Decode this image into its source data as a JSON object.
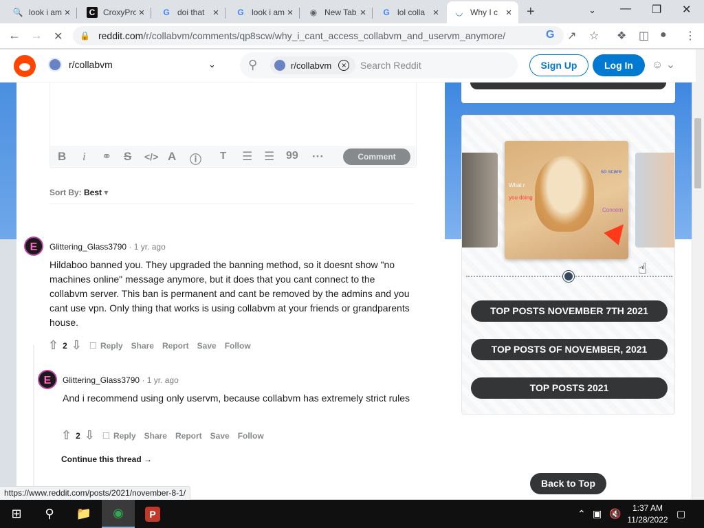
{
  "browser": {
    "tabs": [
      {
        "title": "look i am",
        "icon": "google-search-icon",
        "active": false
      },
      {
        "title": "CroxyProxy",
        "icon": "croxyproxy-icon",
        "active": false
      },
      {
        "title": "doi that",
        "icon": "google-icon",
        "active": false
      },
      {
        "title": "look i am",
        "icon": "google-icon",
        "active": false
      },
      {
        "title": "New Tab",
        "icon": "chrome-icon",
        "active": false
      },
      {
        "title": "lol colla",
        "icon": "google-icon",
        "active": false
      },
      {
        "title": "Why I c",
        "icon": "loading-icon",
        "active": true
      }
    ],
    "url_host": "reddit.com",
    "url_path": "/r/collabvm/comments/qp8scw/why_i_cant_access_collabvm_and_uservm_anymore/",
    "status_url": "https://www.reddit.com/posts/2021/november-8-1/"
  },
  "reddit_header": {
    "subreddit": "r/collabvm",
    "search_chip": "r/collabvm",
    "search_placeholder": "Search Reddit",
    "sign_up": "Sign Up",
    "log_in": "Log In"
  },
  "editor": {
    "comment_button": "Comment",
    "toolbar_icons": [
      "bold-icon",
      "italic-icon",
      "link-icon",
      "strikethrough-icon",
      "inline-code-icon",
      "superscript-icon",
      "spoiler-icon",
      "heading-icon",
      "bulleted-list-icon",
      "numbered-list-icon",
      "quote-icon",
      "more-icon"
    ]
  },
  "sort": {
    "label": "Sort By:",
    "value": "Best"
  },
  "comments": [
    {
      "author": "Glittering_Glass3790",
      "age": "1 yr. ago",
      "text": "Hildaboo banned you. They upgraded the banning method, so it doesnt show \"no machines online\" message anymore, but it does that you cant connect to the collabvm server. This ban is permanent and cant be removed by the admins and you cant use vpn. Only thing that works is using collabvm at your friends or grandparents house.",
      "score": "2",
      "actions": [
        "Reply",
        "Share",
        "Report",
        "Save",
        "Follow"
      ]
    },
    {
      "author": "Glittering_Glass3790",
      "age": "1 yr. ago",
      "text": "And i recommend using only uservm, because collabvm has extremely strict rules",
      "score": "2",
      "actions": [
        "Reply",
        "Share",
        "Report",
        "Save",
        "Follow"
      ]
    }
  ],
  "continue_thread": "Continue this thread",
  "sidebar": {
    "image_texts": [
      "What r",
      "you doing",
      "so scare",
      "Concern"
    ],
    "top_posts": [
      "TOP POSTS NOVEMBER 7TH 2021",
      "TOP POSTS OF NOVEMBER, 2021",
      "TOP POSTS 2021"
    ],
    "back_to_top": "Back to Top"
  },
  "taskbar": {
    "time": "1:37 AM",
    "date": "11/28/2022"
  },
  "colors": {
    "reddit_orange": "#ff4500",
    "reddit_blue": "#0079d3",
    "dark_button": "#343536"
  }
}
